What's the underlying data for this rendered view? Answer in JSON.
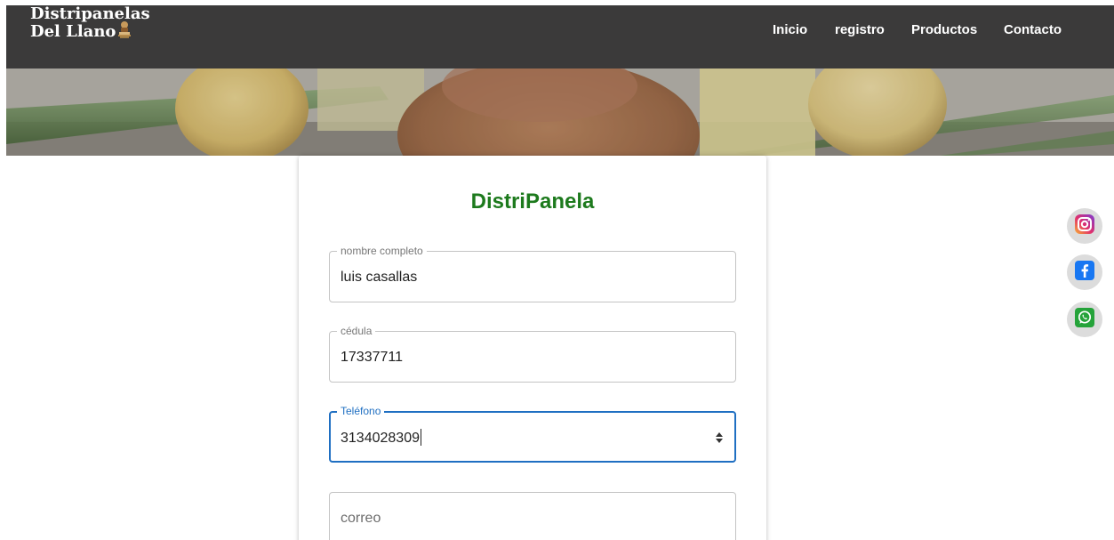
{
  "brand": {
    "line1": "Distripanelas",
    "line2": "Del Llano"
  },
  "nav": {
    "items": [
      {
        "label": "Inicio"
      },
      {
        "label": "registro"
      },
      {
        "label": "Productos"
      },
      {
        "label": "Contacto"
      }
    ]
  },
  "form": {
    "title": "DistriPanela",
    "fields": [
      {
        "label": "nombre completo",
        "value": "luis casallas"
      },
      {
        "label": "cédula",
        "value": "17337711"
      },
      {
        "label": "Teléfono",
        "value": "3134028309"
      },
      {
        "placeholder": "correo"
      }
    ]
  },
  "social": {
    "icons": [
      "instagram-icon",
      "facebook-icon",
      "whatsapp-icon"
    ]
  },
  "colors": {
    "navbar": "#3b3a3a",
    "title_green": "#1d7a1d",
    "focus_blue": "#1f6fc2",
    "facebook_blue": "#1877f2",
    "whatsapp_green": "#25a33a"
  }
}
